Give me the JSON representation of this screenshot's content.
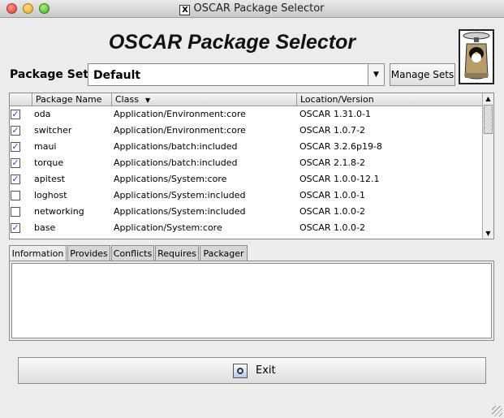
{
  "window": {
    "title": "OSCAR Package Selector",
    "x_icon": "X"
  },
  "heading": "OSCAR Package Selector",
  "package_set": {
    "label": "Package Set:",
    "value": "Default"
  },
  "manage_sets_label": "Manage Sets",
  "table": {
    "headers": [
      "",
      "Package Name",
      "Class",
      "Location/Version"
    ],
    "sort_indicator": "▼",
    "rows": [
      {
        "checked": true,
        "name": "oda",
        "class": "Application/Environment:core",
        "location": "OSCAR 1.31.0-1"
      },
      {
        "checked": true,
        "name": "switcher",
        "class": "Application/Environment:core",
        "location": "OSCAR 1.0.7-2"
      },
      {
        "checked": true,
        "name": "maui",
        "class": "Applications/batch:included",
        "location": "OSCAR 3.2.6p19-8"
      },
      {
        "checked": true,
        "name": "torque",
        "class": "Applications/batch:included",
        "location": "OSCAR 2.1.8-2"
      },
      {
        "checked": true,
        "name": "apitest",
        "class": "Applications/System:core",
        "location": "OSCAR 1.0.0-12.1"
      },
      {
        "checked": false,
        "name": "loghost",
        "class": "Applications/System:included",
        "location": "OSCAR 1.0.0-1"
      },
      {
        "checked": false,
        "name": "networking",
        "class": "Applications/System:included",
        "location": "OSCAR 1.0.0-2"
      },
      {
        "checked": true,
        "name": "base",
        "class": "Application/System:core",
        "location": "OSCAR 1.0.0-2"
      }
    ]
  },
  "tabs": [
    {
      "label": "Information",
      "active": true
    },
    {
      "label": "Provides",
      "active": false
    },
    {
      "label": "Conflicts",
      "active": false
    },
    {
      "label": "Requires",
      "active": false
    },
    {
      "label": "Packager",
      "active": false
    }
  ],
  "exit_label": "Exit",
  "colors": {
    "accent_check": "#1c4fa8",
    "background": "#ececec"
  },
  "icons": [
    "close-traffic-light",
    "minimize-traffic-light",
    "zoom-traffic-light",
    "x11-icon",
    "oscar-logo",
    "exit-icon",
    "resize-grip"
  ]
}
